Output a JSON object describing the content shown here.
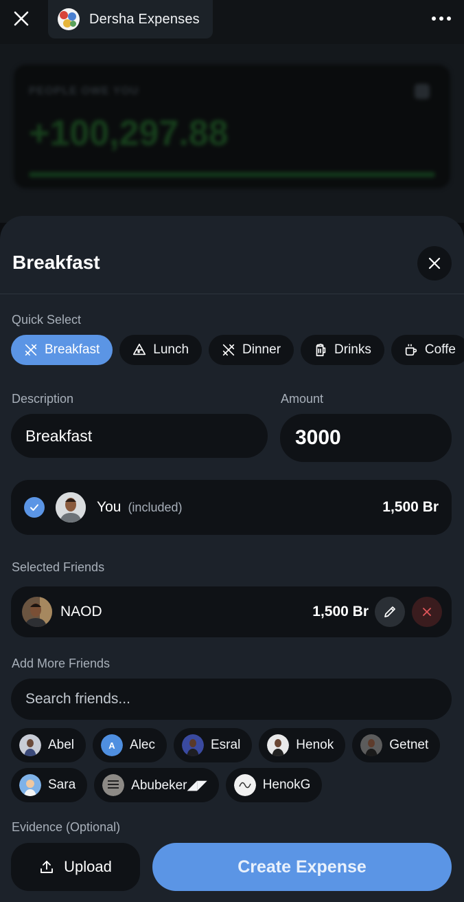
{
  "header": {
    "title": "Dersha Expenses"
  },
  "background_card": {
    "label": "PEOPLE OWE YOU",
    "amount": "+100,297.88"
  },
  "sheet": {
    "title": "Breakfast",
    "quick_select": {
      "label": "Quick Select",
      "chips": [
        {
          "label": "Breakfast",
          "icon": "utensils-icon",
          "active": true
        },
        {
          "label": "Lunch",
          "icon": "pizza-icon",
          "active": false
        },
        {
          "label": "Dinner",
          "icon": "utensils-icon",
          "active": false
        },
        {
          "label": "Drinks",
          "icon": "beer-icon",
          "active": false
        },
        {
          "label": "Coffe",
          "icon": "coffee-icon",
          "active": false
        }
      ]
    },
    "description": {
      "label": "Description",
      "value": "Breakfast"
    },
    "amount": {
      "label": "Amount",
      "value": "3000"
    },
    "you": {
      "name": "You",
      "note": "(included)",
      "share": "1,500 Br",
      "checked": true
    },
    "selected_friends": {
      "label": "Selected Friends",
      "items": [
        {
          "name": "NAOD",
          "share": "1,500 Br"
        }
      ]
    },
    "add_more": {
      "label": "Add More Friends",
      "search_placeholder": "Search friends...",
      "friends_row1": [
        "Abel",
        "Alec",
        "Esral",
        "Henok",
        "Getnet"
      ],
      "friends_row2": [
        "Sara",
        "Abubeker◢◤",
        "HenokG"
      ]
    },
    "evidence": {
      "label": "Evidence (Optional)",
      "upload_label": "Upload"
    },
    "create_label": "Create Expense"
  },
  "colors": {
    "accent": "#5b95e5",
    "sheet_bg": "#1c222a",
    "field_bg": "#0f1216",
    "danger": "#e0555a"
  }
}
